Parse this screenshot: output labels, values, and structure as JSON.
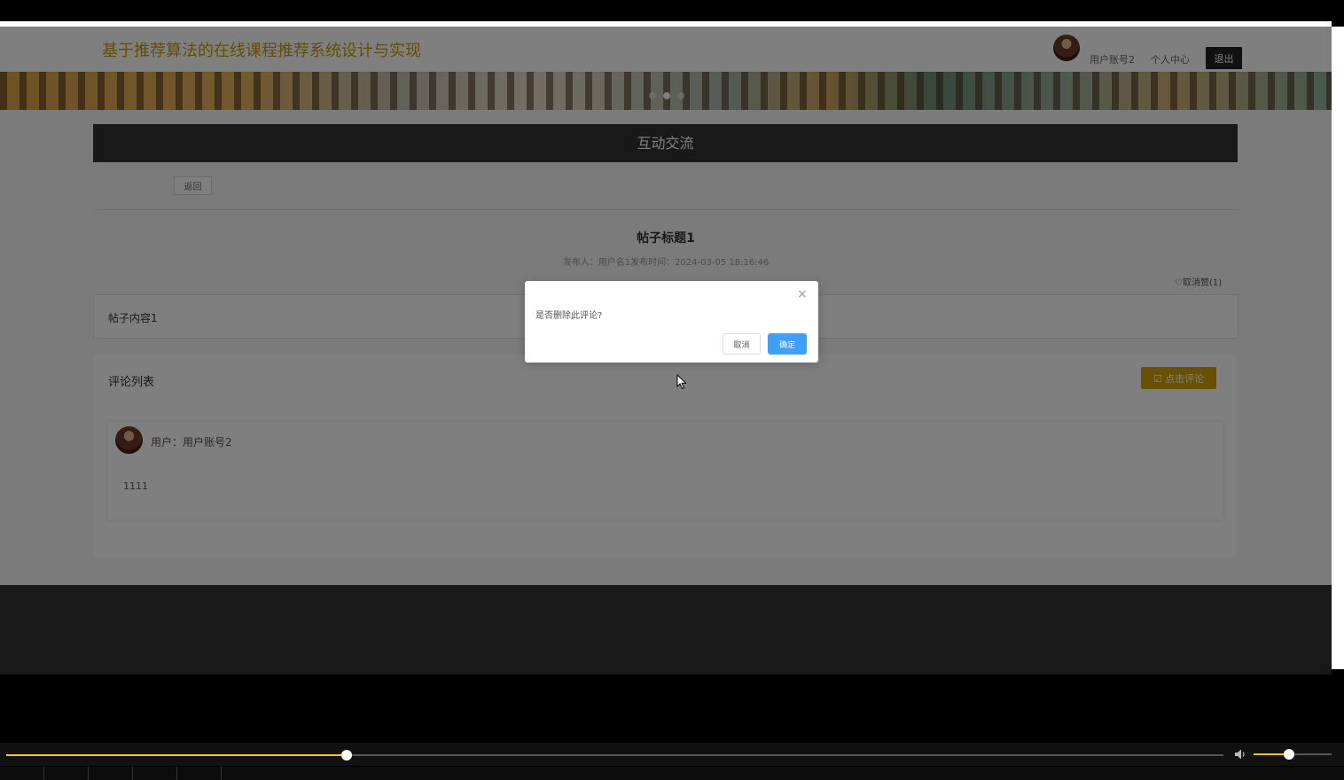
{
  "header": {
    "site_title": "基于推荐算法的在线课程推荐系统设计与实现",
    "username": "用户账号2",
    "personal_center": "个人中心",
    "logout": "退出"
  },
  "section": {
    "title": "互动交流"
  },
  "toolbar": {
    "back": "返回"
  },
  "post": {
    "title": "帖子标题1",
    "meta": "发布人：用户名1发布时间：2024-03-05 18:16:46",
    "like_label": "♡取消赞(1)",
    "content": "帖子内容1"
  },
  "comments": {
    "title": "评论列表",
    "add_button": "☑ 点击评论",
    "items": [
      {
        "user": "用户：用户账号2",
        "text": "1111"
      }
    ]
  },
  "dialog": {
    "message": "是否删除此评论?",
    "cancel": "取消",
    "confirm": "确定",
    "close": "×"
  },
  "player": {
    "progress": 0.28,
    "volume": 0.45
  },
  "colors": {
    "accent": "#d4a007",
    "primary": "#409eff",
    "title": "#c99a00",
    "seek": "#f3c623"
  }
}
